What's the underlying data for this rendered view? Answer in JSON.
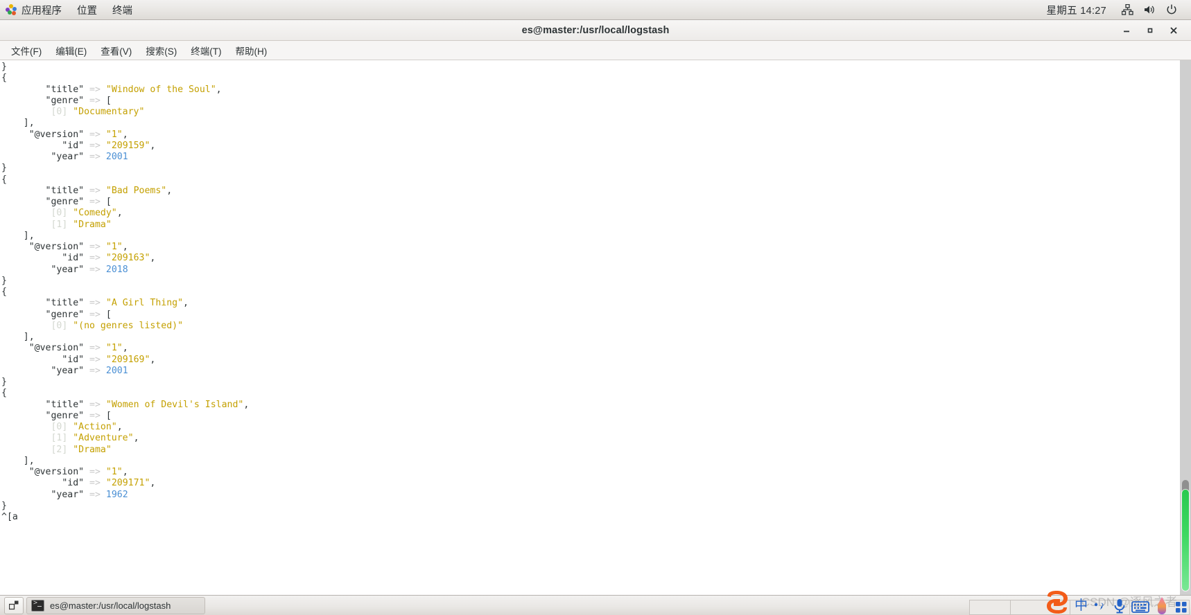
{
  "top_panel": {
    "apps_label": "应用程序",
    "places_label": "位置",
    "terminal_label": "终端",
    "clock": "星期五 14:27",
    "tray": [
      {
        "name": "network-icon",
        "label": "network"
      },
      {
        "name": "volume-icon",
        "label": "volume"
      },
      {
        "name": "power-icon",
        "label": "power"
      }
    ]
  },
  "window": {
    "title": "es@master:/usr/local/logstash",
    "controls": {
      "minimize": "minimize",
      "maximize": "maximize",
      "close": "close"
    },
    "menu": [
      "文件(F)",
      "编辑(E)",
      "查看(V)",
      "搜索(S)",
      "终端(T)",
      "帮助(H)"
    ]
  },
  "terminal": {
    "colors": {
      "key": "#2e3436",
      "arrow": "#c9c9c9",
      "string": "#c4a000",
      "number": "#4a8fd4",
      "index": "#d3d7cf",
      "background": "#ffffff"
    },
    "lines": [
      [
        {
          "t": "}",
          "c": "k"
        }
      ],
      [
        {
          "t": "{",
          "c": "k"
        }
      ],
      [
        {
          "t": "        \"title\" ",
          "c": "k"
        },
        {
          "t": "=> ",
          "c": "ar"
        },
        {
          "t": "\"Window of the Soul\"",
          "c": "s"
        },
        {
          "t": ",",
          "c": "k"
        }
      ],
      [
        {
          "t": "        \"genre\" ",
          "c": "k"
        },
        {
          "t": "=> ",
          "c": "ar"
        },
        {
          "t": "[",
          "c": "k"
        }
      ],
      [
        {
          "t": "         [0] ",
          "c": "ix"
        },
        {
          "t": "\"Documentary\"",
          "c": "s"
        }
      ],
      [
        {
          "t": "    ],",
          "c": "k"
        }
      ],
      [
        {
          "t": "     \"@version\" ",
          "c": "k"
        },
        {
          "t": "=> ",
          "c": "ar"
        },
        {
          "t": "\"1\"",
          "c": "s"
        },
        {
          "t": ",",
          "c": "k"
        }
      ],
      [
        {
          "t": "           \"id\" ",
          "c": "k"
        },
        {
          "t": "=> ",
          "c": "ar"
        },
        {
          "t": "\"209159\"",
          "c": "s"
        },
        {
          "t": ",",
          "c": "k"
        }
      ],
      [
        {
          "t": "         \"year\" ",
          "c": "k"
        },
        {
          "t": "=> ",
          "c": "ar"
        },
        {
          "t": "2001",
          "c": "n"
        }
      ],
      [
        {
          "t": "}",
          "c": "k"
        }
      ],
      [
        {
          "t": "{",
          "c": "k"
        }
      ],
      [
        {
          "t": "        \"title\" ",
          "c": "k"
        },
        {
          "t": "=> ",
          "c": "ar"
        },
        {
          "t": "\"Bad Poems\"",
          "c": "s"
        },
        {
          "t": ",",
          "c": "k"
        }
      ],
      [
        {
          "t": "        \"genre\" ",
          "c": "k"
        },
        {
          "t": "=> ",
          "c": "ar"
        },
        {
          "t": "[",
          "c": "k"
        }
      ],
      [
        {
          "t": "         [0] ",
          "c": "ix"
        },
        {
          "t": "\"Comedy\"",
          "c": "s"
        },
        {
          "t": ",",
          "c": "k"
        }
      ],
      [
        {
          "t": "         [1] ",
          "c": "ix"
        },
        {
          "t": "\"Drama\"",
          "c": "s"
        }
      ],
      [
        {
          "t": "    ],",
          "c": "k"
        }
      ],
      [
        {
          "t": "     \"@version\" ",
          "c": "k"
        },
        {
          "t": "=> ",
          "c": "ar"
        },
        {
          "t": "\"1\"",
          "c": "s"
        },
        {
          "t": ",",
          "c": "k"
        }
      ],
      [
        {
          "t": "           \"id\" ",
          "c": "k"
        },
        {
          "t": "=> ",
          "c": "ar"
        },
        {
          "t": "\"209163\"",
          "c": "s"
        },
        {
          "t": ",",
          "c": "k"
        }
      ],
      [
        {
          "t": "         \"year\" ",
          "c": "k"
        },
        {
          "t": "=> ",
          "c": "ar"
        },
        {
          "t": "2018",
          "c": "n"
        }
      ],
      [
        {
          "t": "}",
          "c": "k"
        }
      ],
      [
        {
          "t": "{",
          "c": "k"
        }
      ],
      [
        {
          "t": "        \"title\" ",
          "c": "k"
        },
        {
          "t": "=> ",
          "c": "ar"
        },
        {
          "t": "\"A Girl Thing\"",
          "c": "s"
        },
        {
          "t": ",",
          "c": "k"
        }
      ],
      [
        {
          "t": "        \"genre\" ",
          "c": "k"
        },
        {
          "t": "=> ",
          "c": "ar"
        },
        {
          "t": "[",
          "c": "k"
        }
      ],
      [
        {
          "t": "         [0] ",
          "c": "ix"
        },
        {
          "t": "\"(no genres listed)\"",
          "c": "s"
        }
      ],
      [
        {
          "t": "    ],",
          "c": "k"
        }
      ],
      [
        {
          "t": "     \"@version\" ",
          "c": "k"
        },
        {
          "t": "=> ",
          "c": "ar"
        },
        {
          "t": "\"1\"",
          "c": "s"
        },
        {
          "t": ",",
          "c": "k"
        }
      ],
      [
        {
          "t": "           \"id\" ",
          "c": "k"
        },
        {
          "t": "=> ",
          "c": "ar"
        },
        {
          "t": "\"209169\"",
          "c": "s"
        },
        {
          "t": ",",
          "c": "k"
        }
      ],
      [
        {
          "t": "         \"year\" ",
          "c": "k"
        },
        {
          "t": "=> ",
          "c": "ar"
        },
        {
          "t": "2001",
          "c": "n"
        }
      ],
      [
        {
          "t": "}",
          "c": "k"
        }
      ],
      [
        {
          "t": "{",
          "c": "k"
        }
      ],
      [
        {
          "t": "        \"title\" ",
          "c": "k"
        },
        {
          "t": "=> ",
          "c": "ar"
        },
        {
          "t": "\"Women of Devil's Island\"",
          "c": "s"
        },
        {
          "t": ",",
          "c": "k"
        }
      ],
      [
        {
          "t": "        \"genre\" ",
          "c": "k"
        },
        {
          "t": "=> ",
          "c": "ar"
        },
        {
          "t": "[",
          "c": "k"
        }
      ],
      [
        {
          "t": "         [0] ",
          "c": "ix"
        },
        {
          "t": "\"Action\"",
          "c": "s"
        },
        {
          "t": ",",
          "c": "k"
        }
      ],
      [
        {
          "t": "         [1] ",
          "c": "ix"
        },
        {
          "t": "\"Adventure\"",
          "c": "s"
        },
        {
          "t": ",",
          "c": "k"
        }
      ],
      [
        {
          "t": "         [2] ",
          "c": "ix"
        },
        {
          "t": "\"Drama\"",
          "c": "s"
        }
      ],
      [
        {
          "t": "    ],",
          "c": "k"
        }
      ],
      [
        {
          "t": "     \"@version\" ",
          "c": "k"
        },
        {
          "t": "=> ",
          "c": "ar"
        },
        {
          "t": "\"1\"",
          "c": "s"
        },
        {
          "t": ",",
          "c": "k"
        }
      ],
      [
        {
          "t": "           \"id\" ",
          "c": "k"
        },
        {
          "t": "=> ",
          "c": "ar"
        },
        {
          "t": "\"209171\"",
          "c": "s"
        },
        {
          "t": ",",
          "c": "k"
        }
      ],
      [
        {
          "t": "         \"year\" ",
          "c": "k"
        },
        {
          "t": "=> ",
          "c": "ar"
        },
        {
          "t": "1962",
          "c": "n"
        }
      ],
      [
        {
          "t": "}",
          "c": "k"
        }
      ],
      [
        {
          "t": "^[a",
          "c": "k"
        }
      ]
    ],
    "scrollbar": {
      "thumb_color": "#3fd862",
      "track_color": "#cfcfcf"
    }
  },
  "taskbar": {
    "show_desktop": "show-desktop",
    "tasks": [
      {
        "label": "es@master:/usr/local/logstash",
        "icon": "terminal-icon"
      }
    ]
  },
  "ime": {
    "logo": "sogou-logo",
    "mode": "中",
    "buttons": [
      {
        "name": "punctuation-icon"
      },
      {
        "name": "microphone-icon"
      },
      {
        "name": "soft-keyboard-icon"
      },
      {
        "name": "skin-icon"
      },
      {
        "name": "menu-grid-icon"
      }
    ],
    "watermark": "CSDN @逐风之者"
  }
}
